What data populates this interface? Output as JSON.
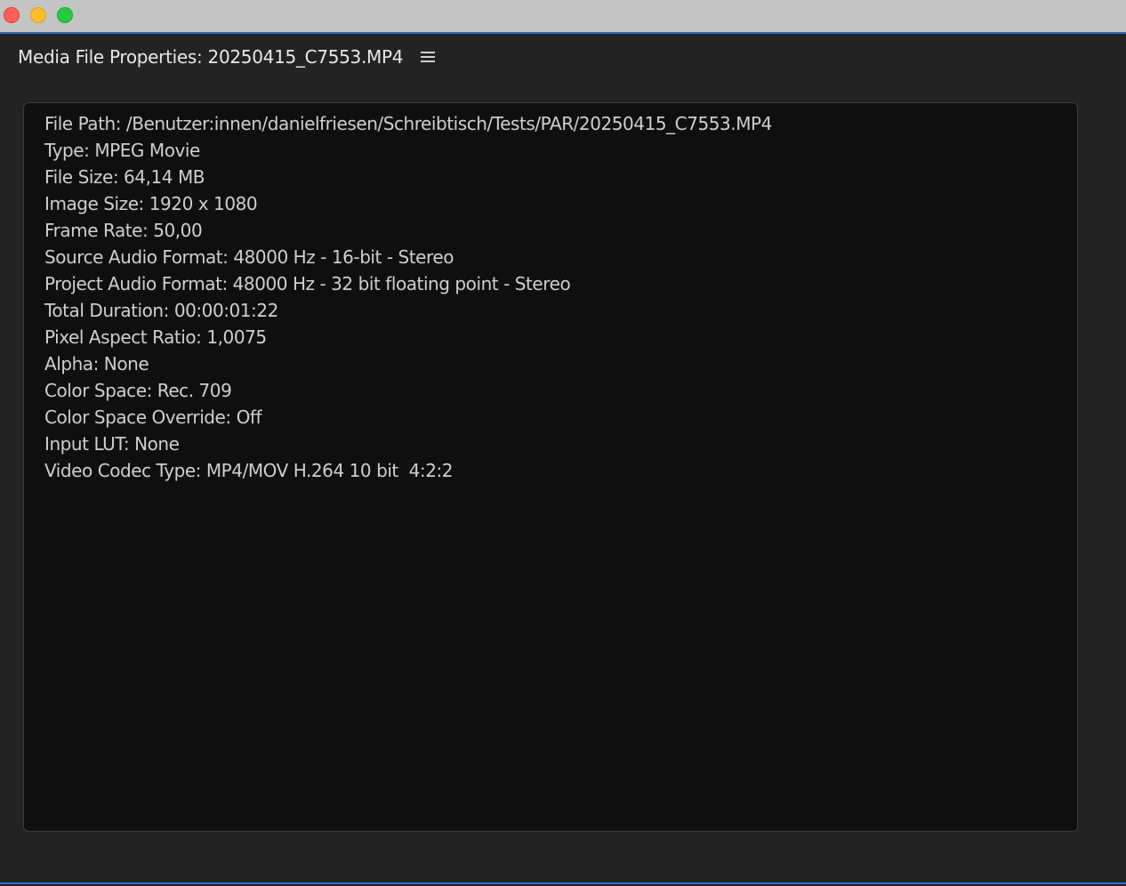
{
  "window": {
    "title_bar_color": "#c4c4c4",
    "accent_color": "#2f6fbf",
    "traffic_lights": {
      "close": "#fe5f57",
      "minimize": "#febc2e",
      "maximize": "#28c840"
    }
  },
  "panel": {
    "title": "Media File Properties: 20250415_C7553.MP4",
    "menu_icon": "hamburger-menu-icon"
  },
  "properties": [
    "File Path: /Benutzer:innen/danielfriesen/Schreibtisch/Tests/PAR/20250415_C7553.MP4",
    "Type: MPEG Movie",
    "File Size: 64,14 MB",
    "Image Size: 1920 x 1080",
    "Frame Rate: 50,00",
    "Source Audio Format: 48000 Hz - 16-bit - Stereo",
    "Project Audio Format: 48000 Hz - 32 bit floating point - Stereo",
    "Total Duration: 00:00:01:22",
    "Pixel Aspect Ratio: 1,0075",
    "Alpha: None",
    "Color Space: Rec. 709",
    "Color Space Override: Off",
    "Input LUT: None",
    "Video Codec Type: MP4/MOV H.264 10 bit  4:2:2"
  ]
}
